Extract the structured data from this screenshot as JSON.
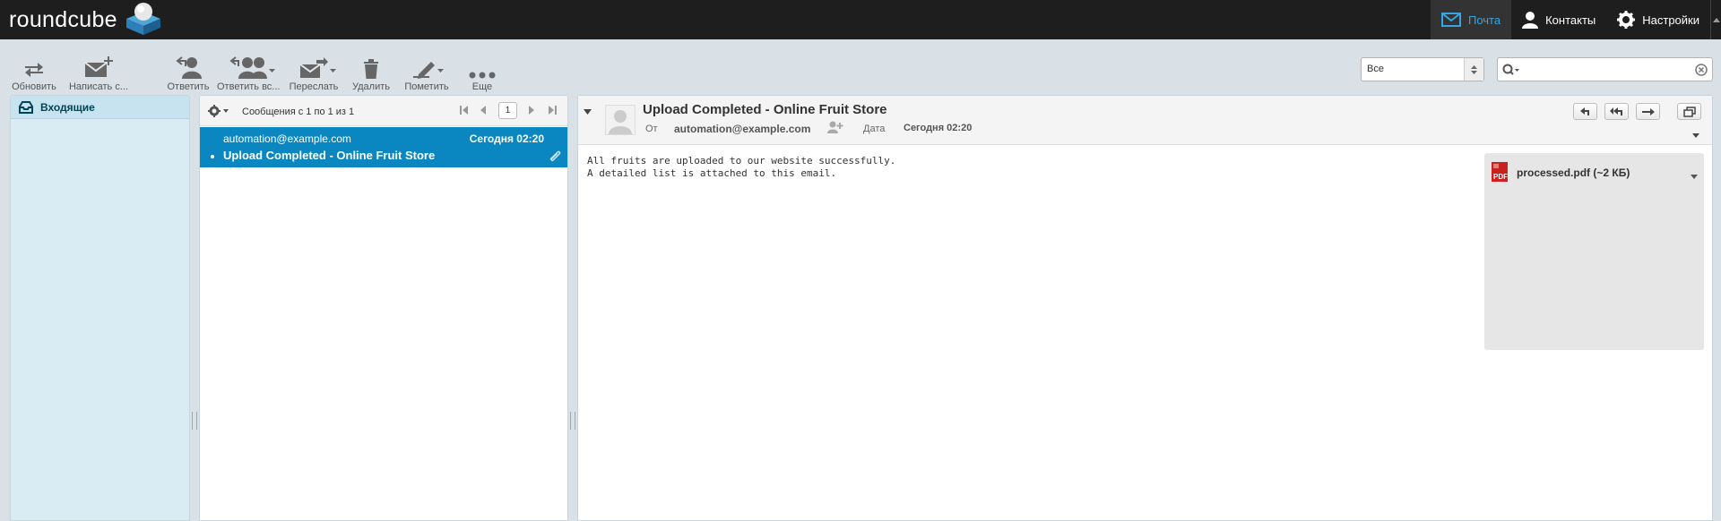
{
  "app": {
    "logo_text": "roundcube"
  },
  "topnav": {
    "mail": "Почта",
    "contacts": "Контакты",
    "settings": "Настройки",
    "active_color": "#37a5e3"
  },
  "toolbar": {
    "refresh": "Обновить",
    "compose": "Написать с...",
    "reply": "Ответить",
    "reply_all": "Ответить вс...",
    "forward": "Переслать",
    "delete": "Удалить",
    "mark": "Пометить",
    "more": "Еще"
  },
  "filter": {
    "selected": "Все"
  },
  "search": {
    "value": ""
  },
  "folders": {
    "items": [
      {
        "label": "Входящие",
        "selected": true
      }
    ]
  },
  "messagelist": {
    "count_text": "Сообщения с 1 по 1 из 1",
    "page": "1",
    "selected_color": "#0a87c1",
    "messages": [
      {
        "from": "automation@example.com",
        "date": "Сегодня 02:20",
        "subject": "Upload Completed - Online Fruit Store",
        "has_attachment": true,
        "unread": true
      }
    ]
  },
  "preview": {
    "subject": "Upload Completed - Online Fruit Store",
    "from_label": "От",
    "from": "automation@example.com",
    "date_label": "Дата",
    "date": "Сегодня 02:20",
    "body": "All fruits are uploaded to our website successfully.\nA detailed list is attached to this email.",
    "attachment": {
      "name": "processed.pdf (~2 КБ)",
      "icon": "pdf-file-icon"
    }
  }
}
